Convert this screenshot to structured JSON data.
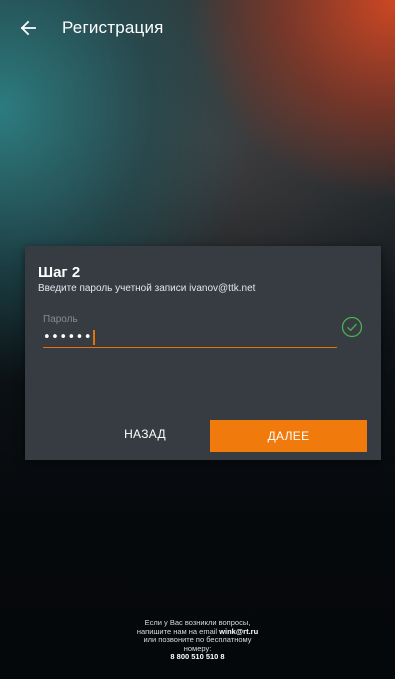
{
  "header": {
    "back_icon": "arrow-left-icon",
    "title": "Регистрация"
  },
  "card": {
    "step_title": "Шаг 2",
    "subtitle": "Введите пароль учетной записи ivanov@ttk.net",
    "password_field": {
      "label": "Пароль",
      "value_masked": "••••••",
      "valid_icon": "check-circle-icon"
    },
    "back_button": "НАЗАД",
    "next_button": "ДАЛЕЕ"
  },
  "footer": {
    "line1": "Если у Вас возникли вопросы,",
    "line2_prefix": "напишите нам на email ",
    "email": "wink@rt.ru",
    "line3": "или позвоните по бесплатному",
    "line4": "номеру:",
    "phone": "8 800 510 510 8"
  },
  "colors": {
    "accent": "#f07a0c",
    "card_bg": "#363c42",
    "valid_check": "#4caf50"
  }
}
